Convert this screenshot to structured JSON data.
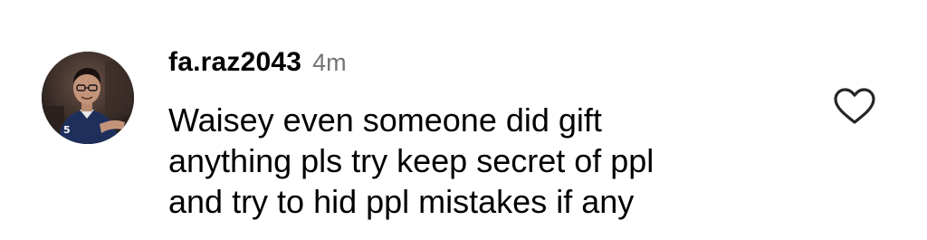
{
  "comment": {
    "username": "fa.raz2043",
    "timestamp": "4m",
    "text_lines": [
      "Waisey even someone did gift",
      "anything pls try keep secret of ppl",
      "and try to hid ppl mistakes if any"
    ],
    "avatar_icon": "profile-photo",
    "like_icon": "heart-outline-icon"
  },
  "colors": {
    "username": "#000000",
    "timestamp": "#737373",
    "text": "#000000",
    "like_icon": "#262626",
    "background": "#ffffff"
  }
}
